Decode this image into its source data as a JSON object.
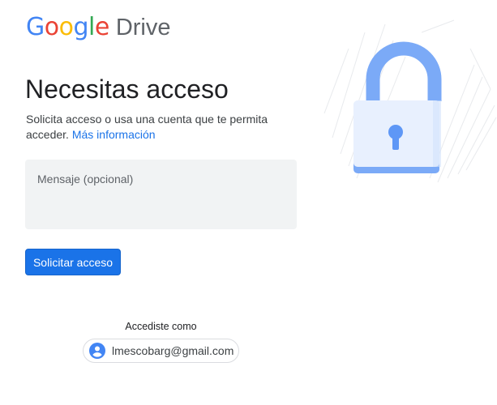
{
  "logo": {
    "letters": [
      {
        "ch": "G",
        "color": "#4285F4"
      },
      {
        "ch": "o",
        "color": "#EA4335"
      },
      {
        "ch": "o",
        "color": "#FBBC05"
      },
      {
        "ch": "g",
        "color": "#4285F4"
      },
      {
        "ch": "l",
        "color": "#34A853"
      },
      {
        "ch": "e",
        "color": "#EA4335"
      }
    ],
    "product": "Drive"
  },
  "main": {
    "title": "Necesitas acceso",
    "description": "Solicita acceso o usa una cuenta que te permita acceder.",
    "more_info_link": "Más información",
    "message_placeholder": "Mensaje (opcional)",
    "request_button": "Solicitar acceso"
  },
  "account": {
    "label": "Accediste como",
    "email": "lmescobarg@gmail.com",
    "avatar_icon": "account-circle-icon"
  },
  "illustration": {
    "icon": "lock-icon"
  },
  "colors": {
    "accent": "#1a73e8",
    "lock_shackle": "#7baaf7",
    "lock_body": "#e8f0fe",
    "keyhole": "#5e97f6"
  }
}
